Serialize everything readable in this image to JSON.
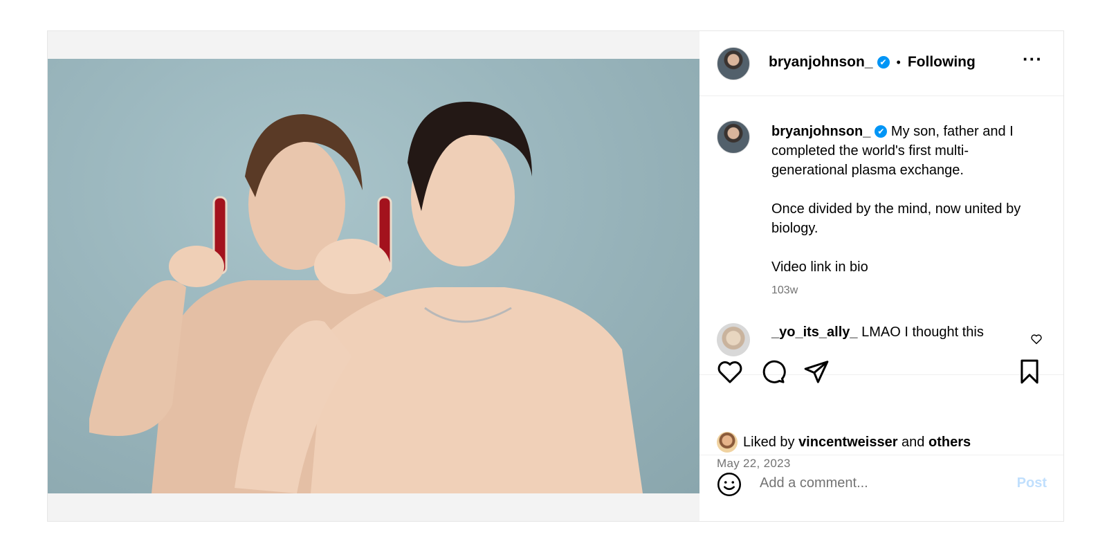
{
  "post": {
    "username": "bryanjohnson_",
    "verified_mark": "✔",
    "separator": "•",
    "follow_status": "Following",
    "more_label": "···",
    "image_alt": "Two shirtless men holding vials of plasma against a grey-blue background"
  },
  "caption": {
    "username": "bryanjohnson_",
    "line1": "My son, father and I completed the world's first multi-generational plasma exchange.",
    "line2": "Once divided by the mind, now united by biology.",
    "line3": "Video link in bio",
    "time_ago": "103w"
  },
  "comment": {
    "username": "_yo_its_ally_",
    "text": "LMAO I thought this"
  },
  "likes": {
    "prefix": "Liked by",
    "user": "vincentweisser",
    "conjunction": "and",
    "others": "others"
  },
  "date": "May 22, 2023",
  "comment_input": {
    "placeholder": "Add a comment...",
    "post_label": "Post"
  },
  "icons": [
    "heart-icon",
    "comment-icon",
    "share-icon",
    "bookmark-icon",
    "emoji-icon",
    "more-icon",
    "verified-icon"
  ],
  "colors": {
    "verified": "#0095f6",
    "post_disabled": "#c0dffd",
    "secondary_text": "#737373"
  }
}
